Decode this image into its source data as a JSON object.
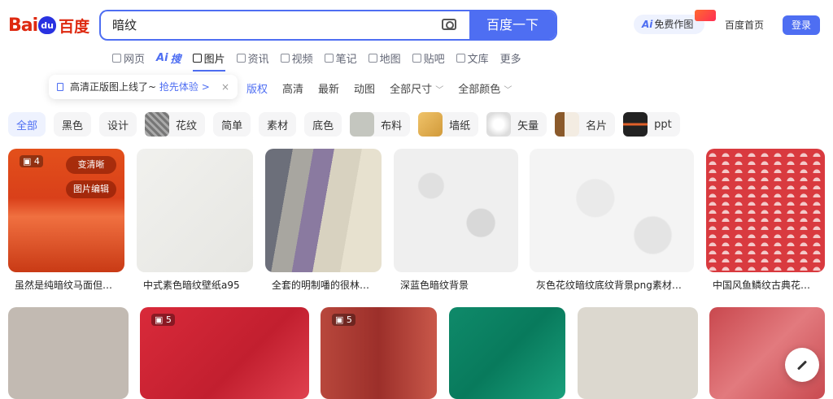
{
  "header": {
    "logo_text": "Bai",
    "logo_paw": "du",
    "logo_cn": "百度",
    "search_value": "暗纹",
    "search_button": "百度一下",
    "ai_pill": "免费作图",
    "ai_prefix": "Ai",
    "home_link": "百度首页",
    "login": "登录"
  },
  "nav": {
    "tabs": [
      {
        "label": "网页"
      },
      {
        "label": "搜",
        "prefix": "Ai"
      },
      {
        "label": "图片"
      },
      {
        "label": "资讯"
      },
      {
        "label": "视频"
      },
      {
        "label": "笔记"
      },
      {
        "label": "地图"
      },
      {
        "label": "贴吧"
      },
      {
        "label": "文库"
      },
      {
        "label": "更多"
      }
    ]
  },
  "notice": {
    "text": "高清正版图上线了~",
    "cta": "抢先体验 >",
    "close": "×"
  },
  "filters": [
    "版权",
    "高清",
    "最新",
    "动图",
    "全部尺寸",
    "全部颜色"
  ],
  "chips": [
    "全部",
    "黑色",
    "设计",
    "花纹",
    "简单",
    "素材",
    "底色",
    "布料",
    "墙纸",
    "矢量",
    "名片",
    "ppt"
  ],
  "row1": [
    {
      "caption": "虽然是纯暗纹马面但…",
      "count": "4",
      "btn1": "变清晰",
      "btn2": "图片编辑"
    },
    {
      "caption": "中式素色暗纹壁纸a95"
    },
    {
      "caption": "全套的明制噃的很林…"
    },
    {
      "caption": "深蓝色暗纹背景"
    },
    {
      "caption": "灰色花纹暗纹底纹背景png素材…"
    },
    {
      "caption": "中国风鱼鳞纹古典花…"
    }
  ],
  "row2": [
    {
      "count": ""
    },
    {
      "count": "5"
    },
    {
      "count": "5"
    },
    {
      "count": ""
    },
    {
      "count": ""
    },
    {
      "count": ""
    }
  ],
  "colors": {
    "accent": "#4e6ef2",
    "logo_red": "#de2910"
  }
}
